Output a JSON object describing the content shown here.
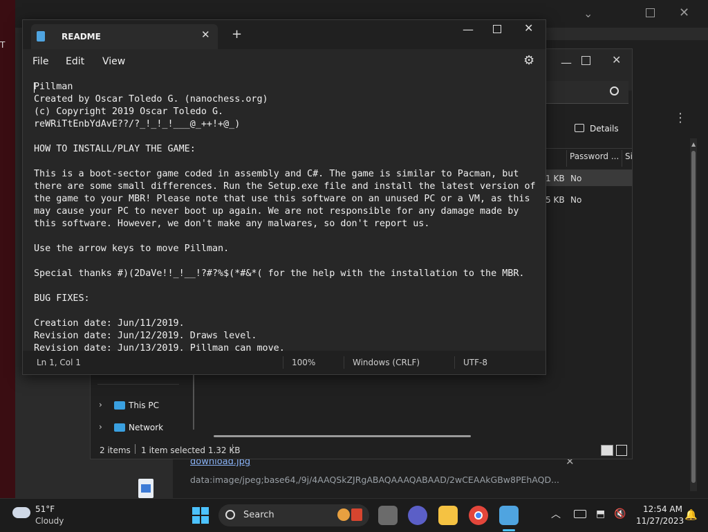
{
  "notepad": {
    "tab_title": "README",
    "add_tab": "+",
    "menu": [
      "File",
      "Edit",
      "View"
    ],
    "content": "Pillman\nCreated by Oscar Toledo G. (nanochess.org)\n(c) Copyright 2019 Oscar Toledo G.\nreWRiTtEnbYdAvE??/?_!_!_!___@_++!+@_)\n\nHOW TO INSTALL/PLAY THE GAME:\n\nThis is a boot-sector game coded in assembly and C#. The game is similar to Pacman, but\nthere are some small differences. Run the Setup.exe file and install the latest version of\nthe game to your MBR! Please note that use this software on an unused PC or a VM, as this\nmay cause your PC to never boot up again. We are not responsible for any damage made by\nthis software. However, we don't make any malwares, so don't report us.\n\nUse the arrow keys to move Pillman.\n\nSpecial thanks #)(2DaVe!!_!__!?#?%$(*#&*( for the help with the installation to the MBR.\n\nBUG FIXES:\n\nCreation date: Jun/11/2019.\nRevision date: Jun/12/2019. Draws level.\nRevision date: Jun/13/2019. Pillman can move.",
    "status": {
      "position": "Ln 1, Col 1",
      "zoom": "100%",
      "line_ending": "Windows (CRLF)",
      "encoding": "UTF-8"
    }
  },
  "explorer": {
    "details_label": "Details",
    "column_password": "Password ...",
    "column_size_partial": "Si",
    "rows": [
      {
        "size_partial": "1 KB",
        "password": "No"
      },
      {
        "size_partial": "5 KB",
        "password": "No"
      }
    ],
    "nav": [
      {
        "label": "This PC"
      },
      {
        "label": "Network"
      }
    ],
    "status_items": "2 items",
    "status_selected": "1 item selected  1.32 KB"
  },
  "download": {
    "filename": "download.jpg",
    "url": "data:image/jpeg;base64,/9j/4AAQSkZJRgABAQAAAQABAAD/2wCEAAkGBw8PEhAQD..."
  },
  "taskbar": {
    "weather_temp": "51°F",
    "weather_desc": "Cloudy",
    "search_label": "Search",
    "time": "12:54 AM",
    "date": "11/27/2023"
  }
}
